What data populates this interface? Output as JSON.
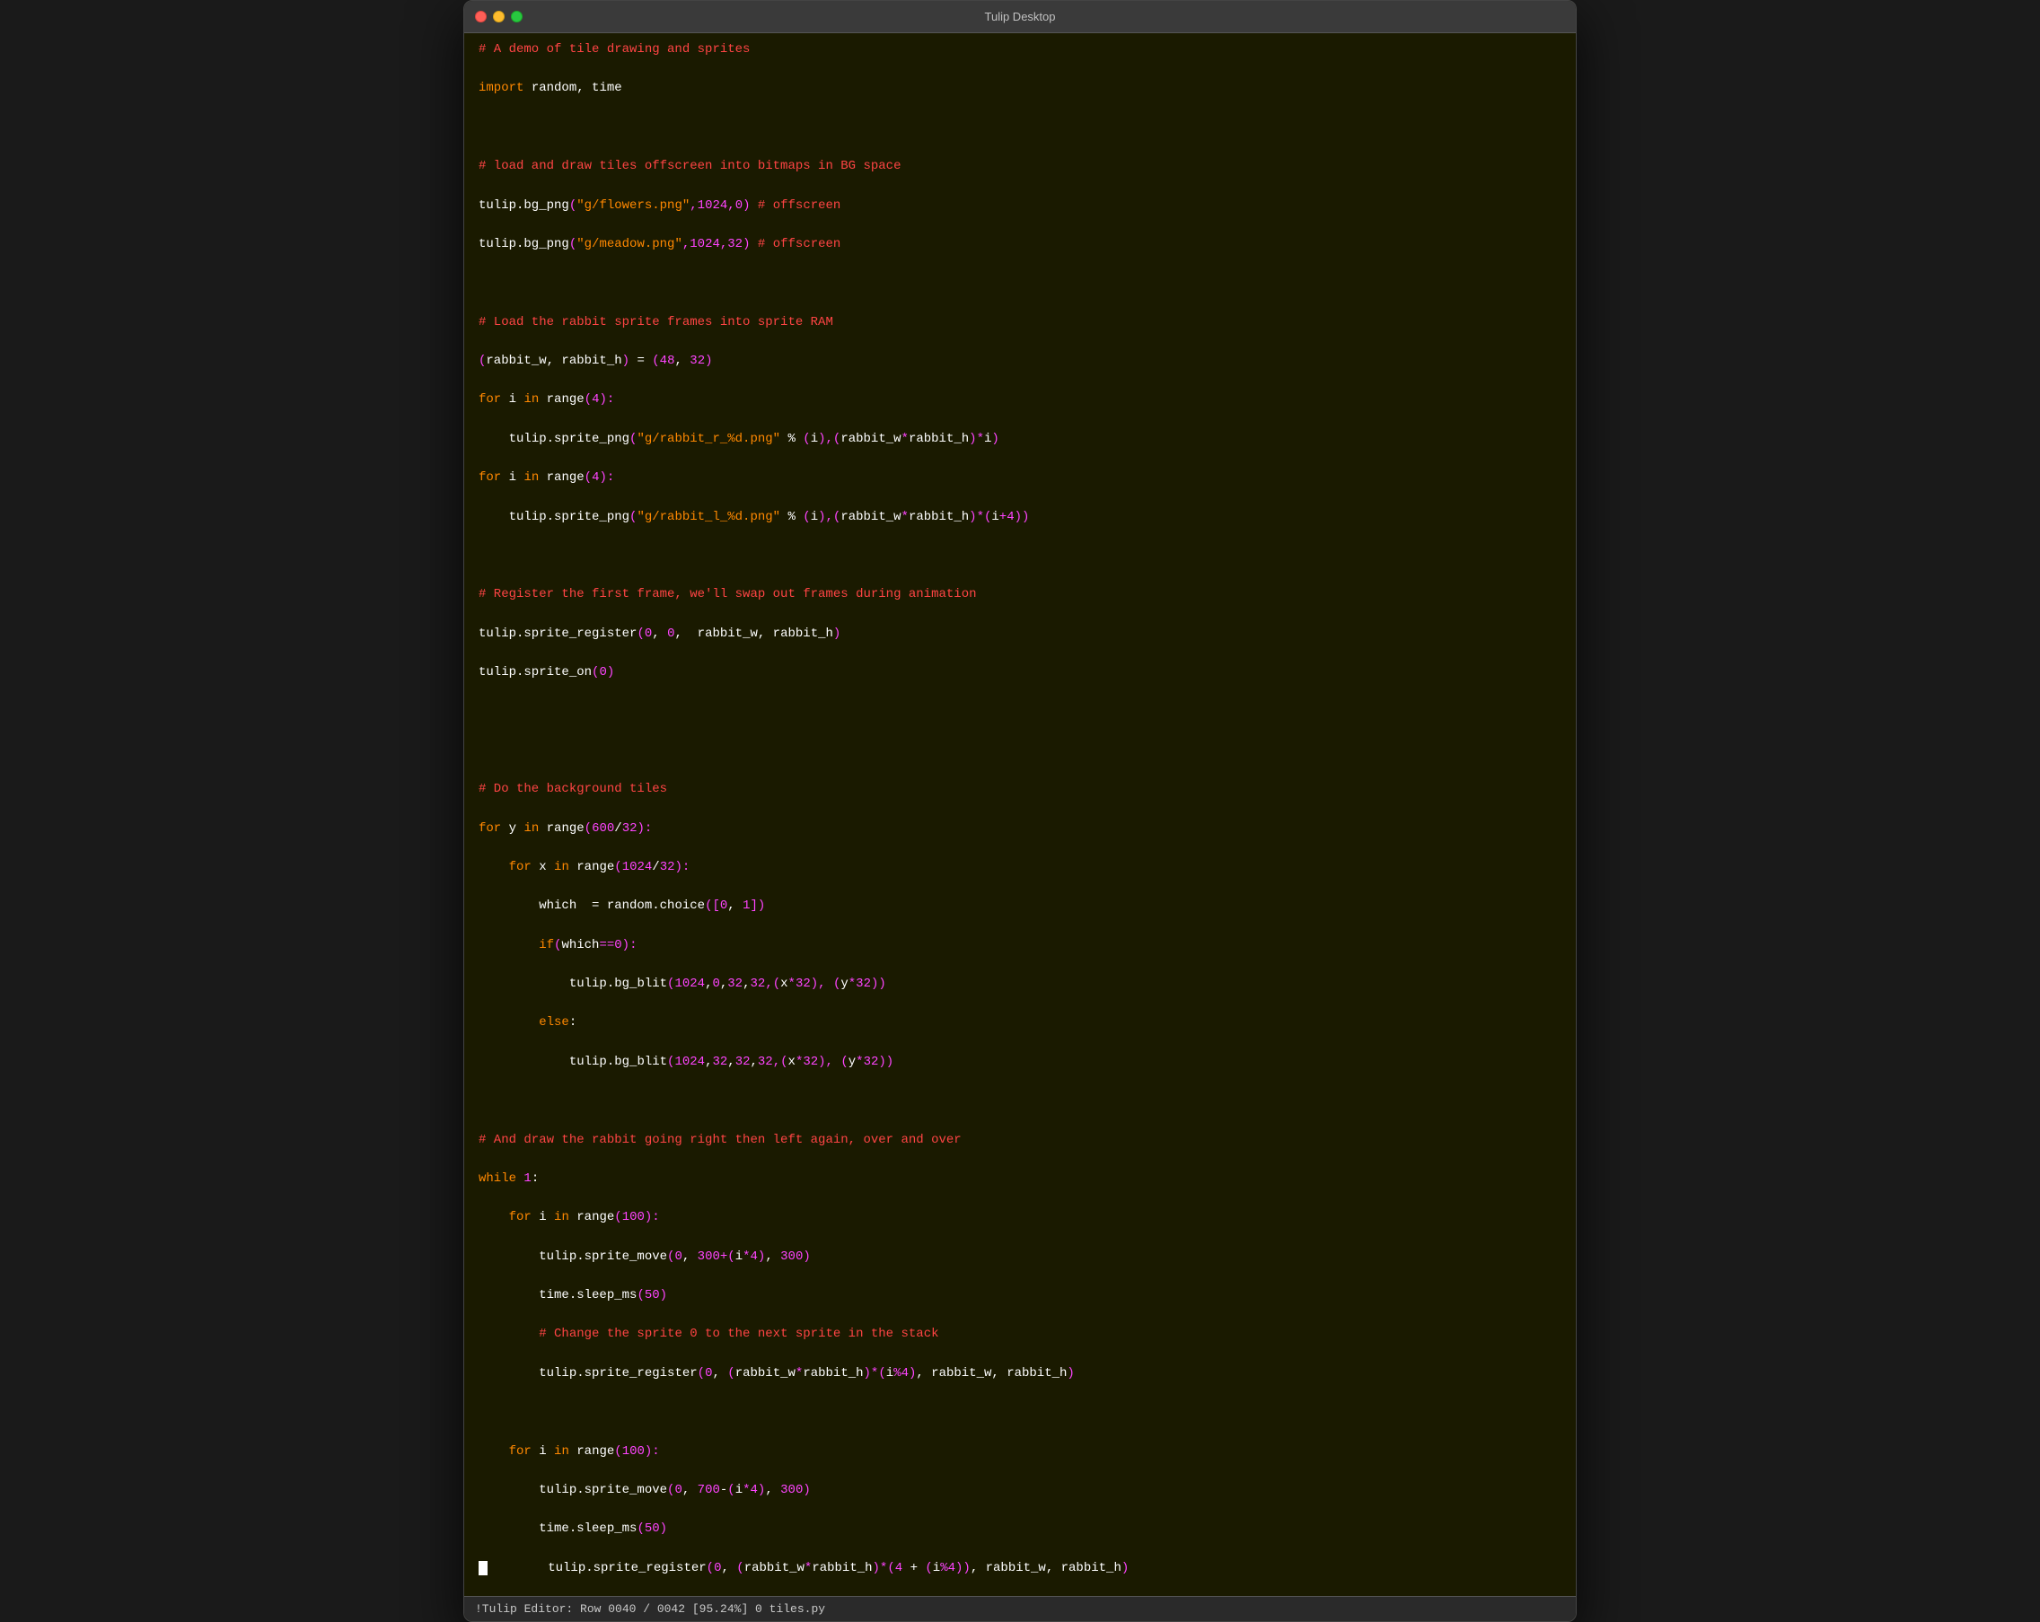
{
  "window": {
    "title": "Tulip Desktop"
  },
  "statusbar": {
    "text": "!Tulip Editor: Row 0040 / 0042 [95.24%]   0 tiles.py"
  },
  "code": {
    "lines": [
      {
        "type": "comment",
        "text": "# A demo of tile drawing and sprites"
      },
      {
        "type": "code",
        "text": "import random, time"
      },
      {
        "type": "blank"
      },
      {
        "type": "comment",
        "text": "# load and draw tiles offscreen into bitmaps in BG space"
      },
      {
        "type": "code_mixed",
        "id": "line_bg1"
      },
      {
        "type": "code_mixed",
        "id": "line_bg2"
      },
      {
        "type": "blank"
      },
      {
        "type": "comment",
        "text": "# Load the rabbit sprite frames into sprite RAM"
      },
      {
        "type": "code_mixed",
        "id": "line_rabbit_assign"
      },
      {
        "type": "code_mixed",
        "id": "line_for1"
      },
      {
        "type": "code_mixed",
        "id": "line_sprite1"
      },
      {
        "type": "code_mixed",
        "id": "line_for2"
      },
      {
        "type": "code_mixed",
        "id": "line_sprite2"
      },
      {
        "type": "blank"
      },
      {
        "type": "comment",
        "text": "# Register the first frame, we'll swap out frames during animation"
      },
      {
        "type": "code_mixed",
        "id": "line_reg1"
      },
      {
        "type": "code_mixed",
        "id": "line_on"
      },
      {
        "type": "blank"
      },
      {
        "type": "blank"
      },
      {
        "type": "comment",
        "text": "# Do the background tiles"
      },
      {
        "type": "code_mixed",
        "id": "line_for_y"
      },
      {
        "type": "code_mixed",
        "id": "line_for_x"
      },
      {
        "type": "code_mixed",
        "id": "line_which"
      },
      {
        "type": "code_mixed",
        "id": "line_if_which"
      },
      {
        "type": "code_mixed",
        "id": "line_blit1"
      },
      {
        "type": "code_mixed",
        "id": "line_else"
      },
      {
        "type": "code_mixed",
        "id": "line_blit2"
      },
      {
        "type": "blank"
      },
      {
        "type": "comment",
        "text": "# And draw the rabbit going right then left again, over and over"
      },
      {
        "type": "code_mixed",
        "id": "line_while"
      },
      {
        "type": "code_mixed",
        "id": "line_for_i1"
      },
      {
        "type": "code_mixed",
        "id": "line_move1"
      },
      {
        "type": "code_mixed",
        "id": "line_sleep1"
      },
      {
        "type": "comment",
        "text": "            # Change the sprite 0 to the next sprite in the stack"
      },
      {
        "type": "code_mixed",
        "id": "line_reg2"
      },
      {
        "type": "blank"
      },
      {
        "type": "code_mixed",
        "id": "line_for_i2"
      },
      {
        "type": "code_mixed",
        "id": "line_move2"
      },
      {
        "type": "code_mixed",
        "id": "line_sleep2"
      },
      {
        "type": "code_mixed",
        "id": "line_reg3"
      }
    ]
  }
}
